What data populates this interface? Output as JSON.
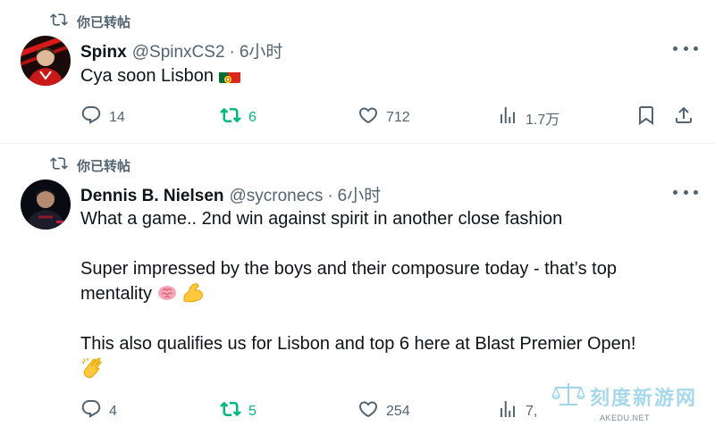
{
  "tweets": [
    {
      "repost_label": "你已转帖",
      "name": "Spinx",
      "handle": "@SpinxCS2",
      "dot": "·",
      "time": "6小时",
      "text": "Cya soon Lisbon",
      "flag_icon": "portugal-flag-icon",
      "actions": {
        "replies": "14",
        "reposts": "6",
        "likes": "712",
        "views": "1.7万"
      }
    },
    {
      "repost_label": "你已转帖",
      "name": "Dennis B. Nielsen",
      "handle": "@sycronecs",
      "dot": "·",
      "time": "6小时",
      "lines": [
        "What a game.. 2nd win against spirit in another close fashion",
        "Super impressed by the boys and their composure today - that’s top",
        "mentality",
        "This also qualifies us for Lisbon and top 6 here at Blast Premier Open!"
      ],
      "actions": {
        "replies": "4",
        "reposts": "5",
        "likes": "254",
        "views": "7,"
      }
    }
  ],
  "watermark": {
    "main": "刻度新游网",
    "sub": "AKEDU.NET"
  },
  "colors": {
    "text": "#0f1419",
    "muted": "#536471",
    "repost_green": "#00ba7c",
    "divider": "#eff3f4"
  }
}
